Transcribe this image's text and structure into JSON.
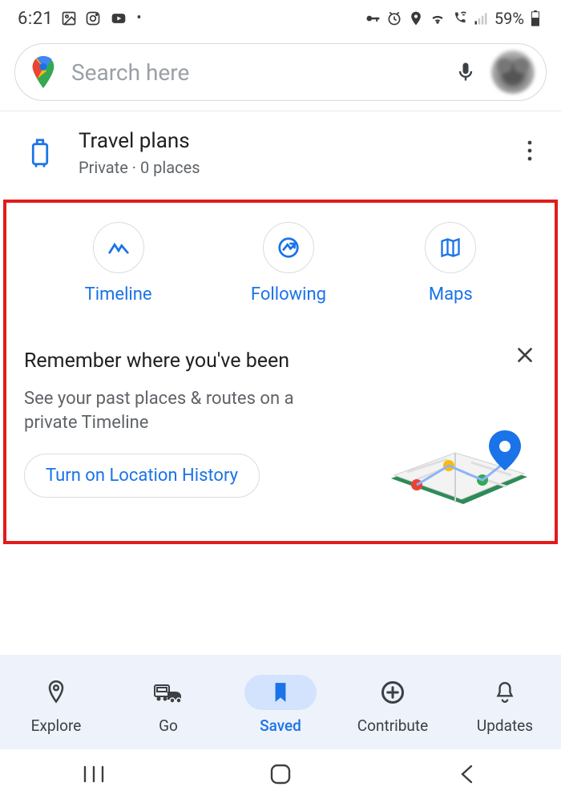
{
  "status": {
    "time": "6:21",
    "battery": "59%"
  },
  "search": {
    "placeholder": "Search here"
  },
  "travel": {
    "title": "Travel plans",
    "subtitle": "Private · 0 places"
  },
  "chips": {
    "timeline": "Timeline",
    "following": "Following",
    "maps": "Maps"
  },
  "promo": {
    "title": "Remember where you've been",
    "subtitle": "See your past places & routes on a private Timeline",
    "button": "Turn on Location History"
  },
  "nav": {
    "explore": "Explore",
    "go": "Go",
    "saved": "Saved",
    "contribute": "Contribute",
    "updates": "Updates"
  }
}
